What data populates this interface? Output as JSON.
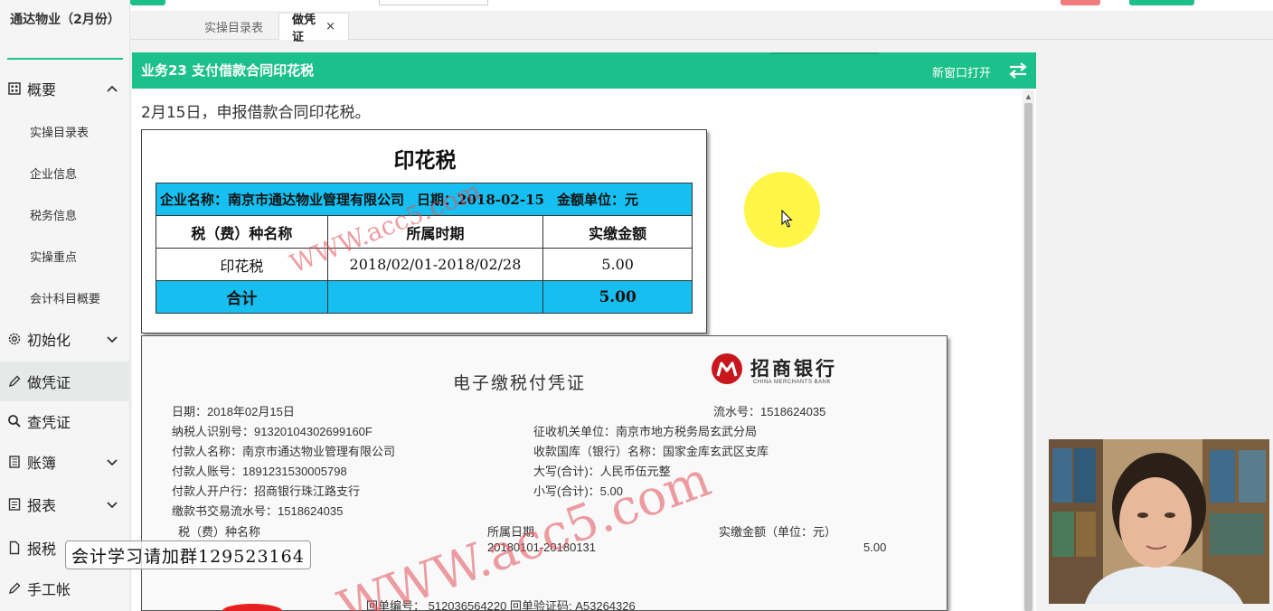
{
  "sidebar": {
    "company": "通达物业（2月份）",
    "items": [
      {
        "label": "概要",
        "icon": "grid-icon",
        "expanded": true
      },
      {
        "label": "初始化",
        "icon": "gear-icon"
      },
      {
        "label": "做凭证",
        "icon": "pencil-icon",
        "active": true
      },
      {
        "label": "查凭证",
        "icon": "search-icon"
      },
      {
        "label": "账簿",
        "icon": "book-icon"
      },
      {
        "label": "报表",
        "icon": "report-icon"
      },
      {
        "label": "报税",
        "icon": "file-icon"
      },
      {
        "label": "手工帐",
        "icon": "pencil-icon"
      }
    ],
    "subitems": [
      "实操目录表",
      "企业信息",
      "税务信息",
      "实操重点",
      "会计科目概要"
    ]
  },
  "tabs": [
    {
      "label": "实操目录表"
    },
    {
      "label": "做凭证",
      "close": "×",
      "active": true
    }
  ],
  "panel": {
    "title": "业务23 支付借款合同印花税",
    "open_new": "新窗口打开",
    "instruction": "2月15日，申报借款合同印花税。"
  },
  "stamp_tax": {
    "title": "印花税",
    "company": "企业名称：南京市通达物业管理有限公司",
    "date": "日期：2018-02-15",
    "unit": "金额单位：元",
    "headers": [
      "税（费）种名称",
      "所属时期",
      "实缴金额"
    ],
    "row": [
      "印花税",
      "2018/02/01-2018/02/28",
      "5.00"
    ],
    "total_label": "合计",
    "total_amount": "5.00"
  },
  "receipt": {
    "title": "电子缴税付凭证",
    "bank_name": "招商银行",
    "bank_en": "CHINA MERCHANTS BANK",
    "date": "日期：2018年02月15日",
    "serial": "流水号：1518624035",
    "taxpayer_id": "纳税人识别号：91320104302699160F",
    "tax_office": "征收机关单位：南京市地方税务局玄武分局",
    "payer_name": "付款人名称：南京市通达物业管理有限公司",
    "treasury": "收款国库（银行）名称：国家金库玄武区支库",
    "payer_account": "付款人账号：1891231530005798",
    "amount_upper": "大写(合计)：人民币伍元整",
    "payer_bank": "付款人开户行：招商银行珠江路支行",
    "amount_lower": "小写(合计)：5.00",
    "tx_serial": "缴款书交易流水号：1518624035",
    "col_tax": "税（费）种名称",
    "col_period": "所属日期",
    "col_amount": "实缴金额（单位：元）",
    "period_value": "20180101-20180131",
    "amount_value": "5.00",
    "receipt_no": "回单编号： 512036564220 回单验证码: A53264326"
  },
  "watermark": "WWW.acc5.com",
  "group_banner": "会计学习请加群129523164"
}
